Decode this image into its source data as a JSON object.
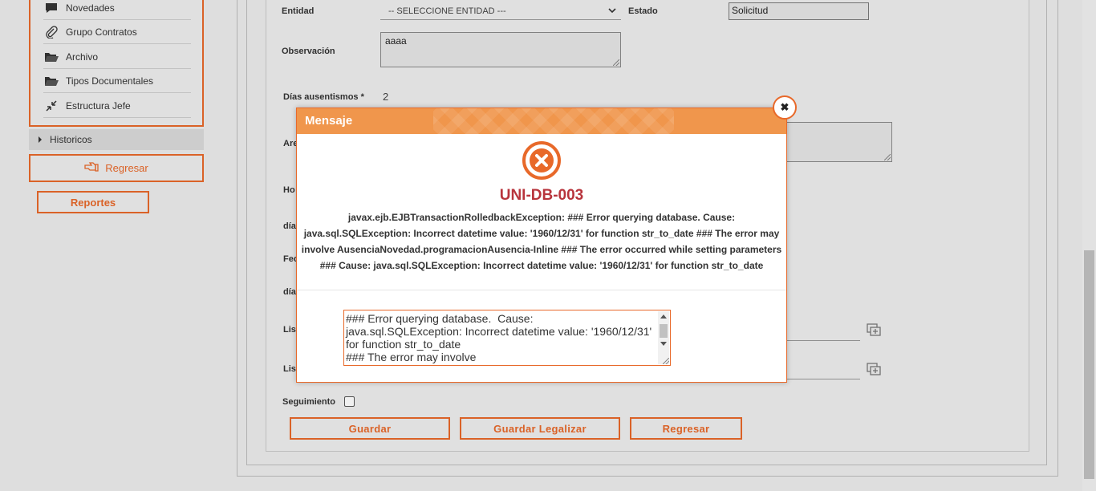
{
  "sidebar": {
    "items": [
      {
        "label": "Novedades",
        "icon": "comment-icon"
      },
      {
        "label": "Grupo Contratos",
        "icon": "paperclip-icon"
      },
      {
        "label": "Archivo",
        "icon": "folder-open-icon"
      },
      {
        "label": "Tipos Documentales",
        "icon": "folder-open-icon"
      },
      {
        "label": "Estructura Jefe",
        "icon": "compress-arrows-icon"
      }
    ],
    "historicos": "Historicos",
    "regresar": "Regresar",
    "reportes": "Reportes"
  },
  "form": {
    "entidad_label": "Entidad",
    "entidad_value": "-- SELECCIONE ENTIDAD ---",
    "estado_label": "Estado",
    "estado_value": "Solicitud",
    "observacion_label": "Observación",
    "observacion_value": "aaaa",
    "dias_label": "Días ausentismos",
    "required_mark": "*",
    "dias_value": "2",
    "partial_labels": [
      "Are",
      "Ho",
      "día",
      "Fec",
      "día",
      "Lis",
      "Lis"
    ],
    "seguimiento_label": "Seguimiento",
    "buttons": {
      "guardar": "Guardar",
      "guardar_legalizar": "Guardar Legalizar",
      "regresar": "Regresar"
    }
  },
  "dialog": {
    "title": "Mensaje",
    "code": "UNI-DB-003",
    "message_lines": [
      "javax.ejb.EJBTransactionRolledbackException: ### Error querying database. Cause:",
      "java.sql.SQLException: Incorrect datetime value: '1960/12/31' for function str_to_date ### The error may",
      "involve AusenciaNovedad.programacionAusencia-Inline ### The error occurred while setting parameters",
      "### Cause: java.sql.SQLException: Incorrect datetime value: '1960/12/31' for function str_to_date"
    ],
    "detail_text": "### Error querying database.  Cause: java.sql.SQLException: Incorrect datetime value: '1960/12/31' for function str_to_date\n### The error may involve AusenciaNovedad.programacionAusencia-Inline",
    "close_symbol": "✖"
  },
  "colors": {
    "accent": "#e8692a",
    "header": "#f0964c",
    "error_code": "#b8343c"
  }
}
